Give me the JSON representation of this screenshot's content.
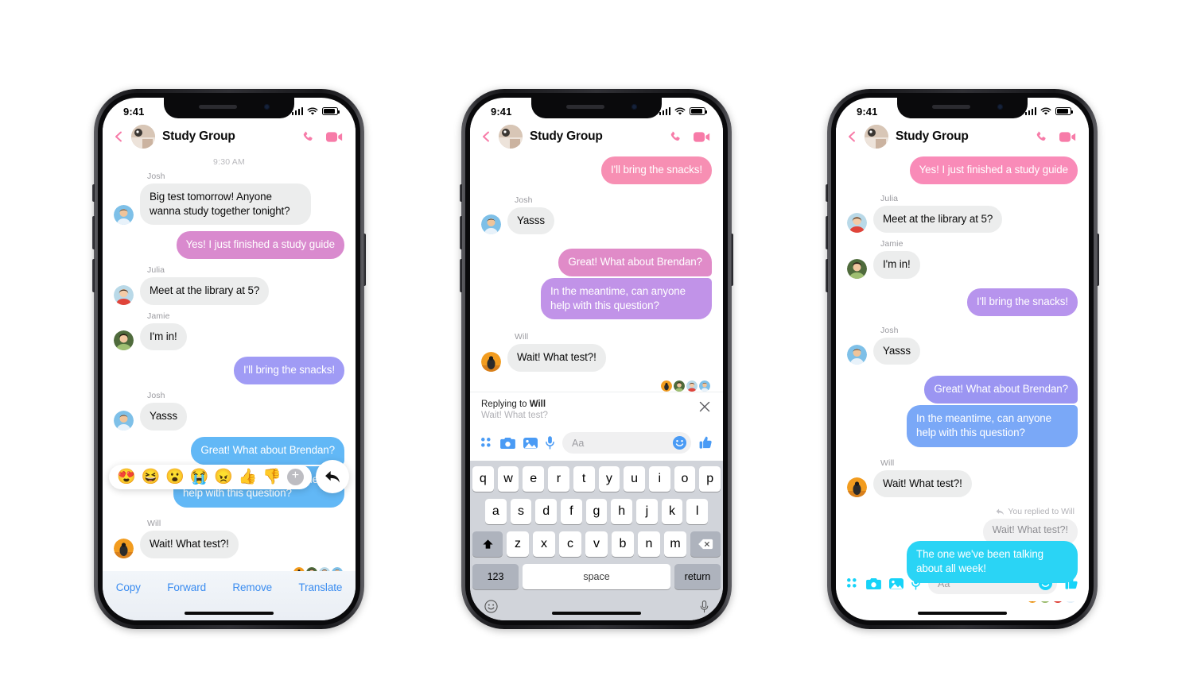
{
  "status_bar": {
    "time": "9:41",
    "signal_icon": "cellular-bars-icon",
    "wifi_icon": "wifi-icon",
    "battery_icon": "battery-icon"
  },
  "header": {
    "title": "Study Group",
    "back_icon": "back-chevron-icon",
    "avatar_name": "group-avatar",
    "call_icon": "phone-call-icon",
    "video_icon": "video-call-icon"
  },
  "phone1": {
    "daystamp": "9:30 AM",
    "messages": [
      {
        "sender": "Josh",
        "text": "Big test tomorrow! Anyone wanna study together tonight?",
        "side": "in"
      },
      {
        "sender": "",
        "text": "Yes! I just finished a study guide",
        "side": "out",
        "color": "#d98ace"
      },
      {
        "sender": "Julia",
        "text": "Meet at the library at 5?",
        "side": "in"
      },
      {
        "sender": "Jamie",
        "text": "I'm in!",
        "side": "in"
      },
      {
        "sender": "",
        "text": "I'll bring the snacks!",
        "side": "out",
        "color": "#a09bf5"
      },
      {
        "sender": "Josh",
        "text": "Yasss",
        "side": "in"
      },
      {
        "sender": "",
        "text": "Great! What about Brendan?",
        "side": "out",
        "color": "#62b8f6"
      },
      {
        "sender": "",
        "text": "In the meantime, can anyone help with this question?",
        "side": "out",
        "color": "#62b8f6"
      },
      {
        "sender": "Will",
        "text": "Wait! What test?!",
        "side": "in"
      }
    ],
    "reactions": [
      "😍",
      "😆",
      "😮",
      "😭",
      "😠",
      "👍",
      "👎"
    ],
    "add_reaction_label": "+",
    "reply_icon": "reply-arrow-icon",
    "action_menu": [
      "Copy",
      "Forward",
      "Remove",
      "Translate"
    ]
  },
  "phone2": {
    "messages": [
      {
        "sender": "",
        "text": "I'll bring the snacks!",
        "side": "out",
        "color": "#f78fb3"
      },
      {
        "sender": "Josh",
        "text": "Yasss",
        "side": "in"
      },
      {
        "sender": "",
        "text": "Great! What about Brendan?",
        "side": "out",
        "color": "#e08bc8"
      },
      {
        "sender": "",
        "text": "In the meantime, can anyone help with this question?",
        "side": "out",
        "color": "#c193e8"
      },
      {
        "sender": "Will",
        "text": "Wait! What test?!",
        "side": "in"
      }
    ],
    "reply_banner": {
      "prefix": "Replying to ",
      "name": "Will",
      "quote": "Wait! What test?",
      "close_icon": "close-x-icon"
    },
    "composer": {
      "accent": "#4a9bf5",
      "grid_icon": "app-grid-icon",
      "camera_icon": "camera-icon",
      "gallery_icon": "photo-gallery-icon",
      "mic_icon": "microphone-icon",
      "placeholder": "Aa",
      "emoji_icon": "smiley-emoji-icon",
      "thumb_icon": "thumbs-up-icon"
    },
    "keyboard": {
      "row1": [
        "q",
        "w",
        "e",
        "r",
        "t",
        "y",
        "u",
        "i",
        "o",
        "p"
      ],
      "row2": [
        "a",
        "s",
        "d",
        "f",
        "g",
        "h",
        "j",
        "k",
        "l"
      ],
      "row3": [
        "z",
        "x",
        "c",
        "v",
        "b",
        "n",
        "m"
      ],
      "shift_icon": "shift-arrow-icon",
      "backspace_icon": "backspace-icon",
      "numbers_key": "123",
      "space_key": "space",
      "return_key": "return",
      "emoji_key_icon": "emoji-keyboard-icon",
      "dictation_icon": "dictation-mic-icon"
    }
  },
  "phone3": {
    "messages": [
      {
        "sender": "",
        "text": "Yes! I just finished a study guide",
        "side": "out",
        "color": "#f98bb8"
      },
      {
        "sender": "Julia",
        "text": "Meet at the library at 5?",
        "side": "in"
      },
      {
        "sender": "Jamie",
        "text": "I'm in!",
        "side": "in"
      },
      {
        "sender": "",
        "text": "I'll bring the snacks!",
        "side": "out",
        "color": "#b794ed"
      },
      {
        "sender": "Josh",
        "text": "Yasss",
        "side": "in"
      },
      {
        "sender": "",
        "text": "Great! What about Brendan?",
        "side": "out",
        "color": "#9b95f2"
      },
      {
        "sender": "",
        "text": "In the meantime, can anyone help with this question?",
        "side": "out",
        "color": "#7aa8f7"
      },
      {
        "sender": "Will",
        "text": "Wait! What test?!",
        "side": "in"
      }
    ],
    "reply_thread": {
      "meta_icon": "reply-arrow-small-icon",
      "meta": "You replied to Will",
      "quote": "Wait! What test?!",
      "answer": "The one we've been talking about all week!",
      "answer_color": "#2ad4f5"
    },
    "composer": {
      "accent": "#16d3f8",
      "grid_icon": "app-grid-icon",
      "camera_icon": "camera-icon",
      "gallery_icon": "photo-gallery-icon",
      "mic_icon": "microphone-icon",
      "placeholder": "Aa",
      "emoji_icon": "smiley-emoji-icon",
      "thumb_icon": "thumbs-up-icon"
    }
  },
  "avatars": {
    "josh": {
      "bg": "#7ec0e8",
      "skin": "#f0c49a",
      "hair": "#2f2b28",
      "shirt": "#e8f2fa"
    },
    "julia": {
      "bg": "#b9d9e8",
      "skin": "#f3cba6",
      "hair": "#4a3426",
      "shirt": "#e0443a"
    },
    "jamie": {
      "bg": "#4f6b3c",
      "skin": "#f2c7a0",
      "hair": "#2a1d14",
      "shirt": "#9fbf72"
    },
    "will": {
      "bg": "#f29c1f",
      "skin": "#d8801c",
      "hair": "#1b1b1b",
      "shirt": "#2b2b2b"
    }
  }
}
